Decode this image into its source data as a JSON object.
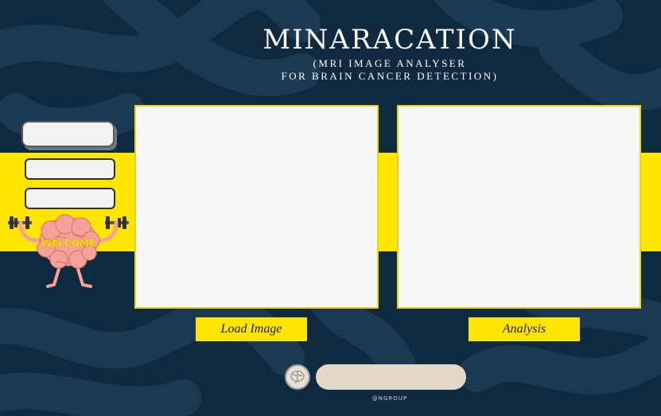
{
  "app": {
    "title": "MINARACATION",
    "subtitle_line1": "(MRI IMAGE ANALYSER",
    "subtitle_line2": "FOR BRAIN CANCER DETECTION)"
  },
  "mascot": {
    "welcome_text": "WELCOME",
    "icon": "brain-dumbbell-mascot-icon"
  },
  "sidebar": {
    "fields": [
      {
        "value": ""
      },
      {
        "value": ""
      },
      {
        "value": ""
      }
    ]
  },
  "buttons": {
    "load_label": "Load Image",
    "analysis_label": "Analysis"
  },
  "footer": {
    "status_text": "",
    "credit": "@NGROUP",
    "status_icon": "brain-icon"
  },
  "colors": {
    "background": "#0f2a3e",
    "accent": "#ffe500",
    "panel": "#f7f8f9",
    "mascot": "#f4a39a"
  }
}
